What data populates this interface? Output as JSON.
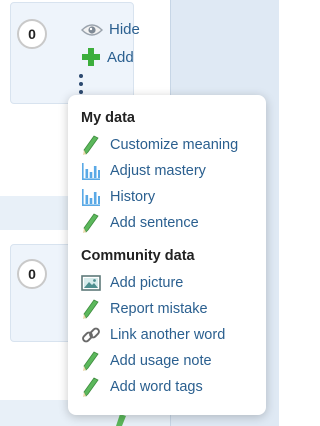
{
  "cards": [
    {
      "counter": "0",
      "actions": [
        {
          "label": "Hide",
          "icon": "eye-icon"
        },
        {
          "label": "Add",
          "icon": "plus-icon"
        }
      ]
    },
    {
      "counter": "0"
    }
  ],
  "menu": {
    "sections": [
      {
        "heading": "My data",
        "items": [
          {
            "label": "Customize meaning",
            "icon": "pencil-icon"
          },
          {
            "label": "Adjust mastery",
            "icon": "bar-chart-icon"
          },
          {
            "label": "History",
            "icon": "bar-chart-icon"
          },
          {
            "label": "Add sentence",
            "icon": "pencil-icon"
          }
        ]
      },
      {
        "heading": "Community data",
        "items": [
          {
            "label": "Add picture",
            "icon": "picture-icon"
          },
          {
            "label": "Report mistake",
            "icon": "pencil-icon"
          },
          {
            "label": "Link another word",
            "icon": "link-icon"
          },
          {
            "label": "Add usage note",
            "icon": "pencil-icon"
          },
          {
            "label": "Add word tags",
            "icon": "pencil-icon"
          }
        ]
      }
    ]
  },
  "colors": {
    "link": "#2a5f8f",
    "card_bg": "#eef4fb",
    "right_panel_bg": "#dfe9f4",
    "pencil_green": "#5cb85c",
    "chart_blue": "#5aa9e6"
  }
}
